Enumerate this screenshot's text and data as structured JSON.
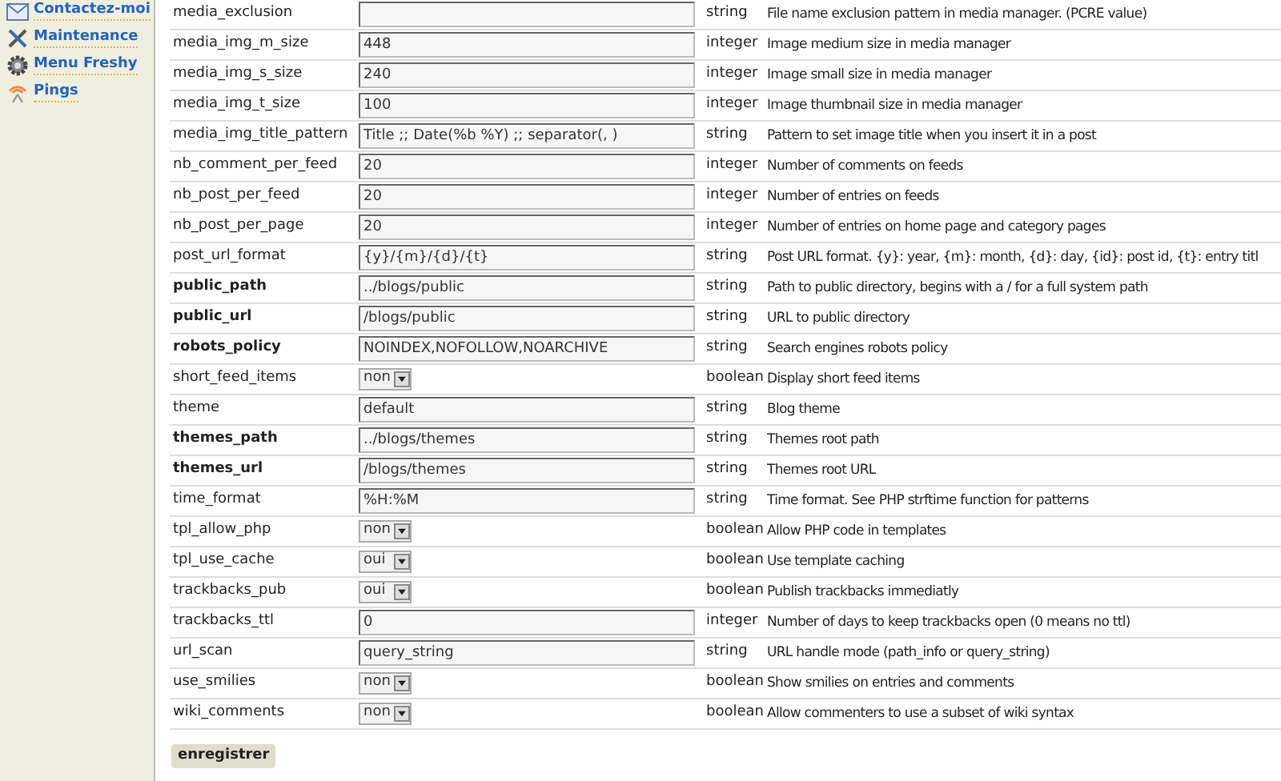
{
  "sidebar": {
    "items": [
      {
        "label": "Contactez-moi"
      },
      {
        "label": "Maintenance"
      },
      {
        "label": "Menu Freshy"
      },
      {
        "label": "Pings"
      }
    ]
  },
  "settings": {
    "rows": [
      {
        "name": "media_exclusion",
        "bold": false,
        "kind": "text",
        "value": "",
        "type": "string",
        "description": "File name exclusion pattern in media manager. (PCRE value)"
      },
      {
        "name": "media_img_m_size",
        "bold": false,
        "kind": "text",
        "value": "448",
        "type": "integer",
        "description": "Image medium size in media manager"
      },
      {
        "name": "media_img_s_size",
        "bold": false,
        "kind": "text",
        "value": "240",
        "type": "integer",
        "description": "Image small size in media manager"
      },
      {
        "name": "media_img_t_size",
        "bold": false,
        "kind": "text",
        "value": "100",
        "type": "integer",
        "description": "Image thumbnail size in media manager"
      },
      {
        "name": "media_img_title_pattern",
        "bold": false,
        "kind": "text",
        "value": "Title ;; Date(%b %Y) ;; separator(, )",
        "type": "string",
        "description": "Pattern to set image title when you insert it in a post"
      },
      {
        "name": "nb_comment_per_feed",
        "bold": false,
        "kind": "text",
        "value": "20",
        "type": "integer",
        "description": "Number of comments on feeds"
      },
      {
        "name": "nb_post_per_feed",
        "bold": false,
        "kind": "text",
        "value": "20",
        "type": "integer",
        "description": "Number of entries on feeds"
      },
      {
        "name": "nb_post_per_page",
        "bold": false,
        "kind": "text",
        "value": "20",
        "type": "integer",
        "description": "Number of entries on home page and category pages"
      },
      {
        "name": "post_url_format",
        "bold": false,
        "kind": "text",
        "value": "{y}/{m}/{d}/{t}",
        "type": "string",
        "description": "Post URL format. {y}: year, {m}: month, {d}: day, {id}: post id, {t}: entry titl"
      },
      {
        "name": "public_path",
        "bold": true,
        "kind": "text",
        "value": "../blogs/public",
        "type": "string",
        "description": "Path to public directory, begins with a / for a full system path"
      },
      {
        "name": "public_url",
        "bold": true,
        "kind": "text",
        "value": "/blogs/public",
        "type": "string",
        "description": "URL to public directory"
      },
      {
        "name": "robots_policy",
        "bold": true,
        "kind": "text",
        "value": "NOINDEX,NOFOLLOW,NOARCHIVE",
        "type": "string",
        "description": "Search engines robots policy"
      },
      {
        "name": "short_feed_items",
        "bold": false,
        "kind": "select",
        "value": "non",
        "type": "boolean",
        "description": "Display short feed items"
      },
      {
        "name": "theme",
        "bold": false,
        "kind": "text",
        "value": "default",
        "type": "string",
        "description": "Blog theme"
      },
      {
        "name": "themes_path",
        "bold": true,
        "kind": "text",
        "value": "../blogs/themes",
        "type": "string",
        "description": "Themes root path"
      },
      {
        "name": "themes_url",
        "bold": true,
        "kind": "text",
        "value": "/blogs/themes",
        "type": "string",
        "description": "Themes root URL"
      },
      {
        "name": "time_format",
        "bold": false,
        "kind": "text",
        "value": "%H:%M",
        "type": "string",
        "description": "Time format. See PHP strftime function for patterns"
      },
      {
        "name": "tpl_allow_php",
        "bold": false,
        "kind": "select",
        "value": "non",
        "type": "boolean",
        "description": "Allow PHP code in templates"
      },
      {
        "name": "tpl_use_cache",
        "bold": false,
        "kind": "select",
        "value": "oui",
        "type": "boolean",
        "description": "Use template caching"
      },
      {
        "name": "trackbacks_pub",
        "bold": false,
        "kind": "select",
        "value": "oui",
        "type": "boolean",
        "description": "Publish trackbacks immediatly"
      },
      {
        "name": "trackbacks_ttl",
        "bold": false,
        "kind": "text",
        "value": "0",
        "type": "integer",
        "description": "Number of days to keep trackbacks open (0 means no ttl)"
      },
      {
        "name": "url_scan",
        "bold": false,
        "kind": "text",
        "value": "query_string",
        "type": "string",
        "description": "URL handle mode (path_info or query_string)"
      },
      {
        "name": "use_smilies",
        "bold": false,
        "kind": "select",
        "value": "non",
        "type": "boolean",
        "description": "Show smilies on entries and comments"
      },
      {
        "name": "wiki_comments",
        "bold": false,
        "kind": "select",
        "value": "non",
        "type": "boolean",
        "description": "Allow commenters to use a subset of wiki syntax"
      }
    ]
  },
  "save_button": "enregistrer"
}
